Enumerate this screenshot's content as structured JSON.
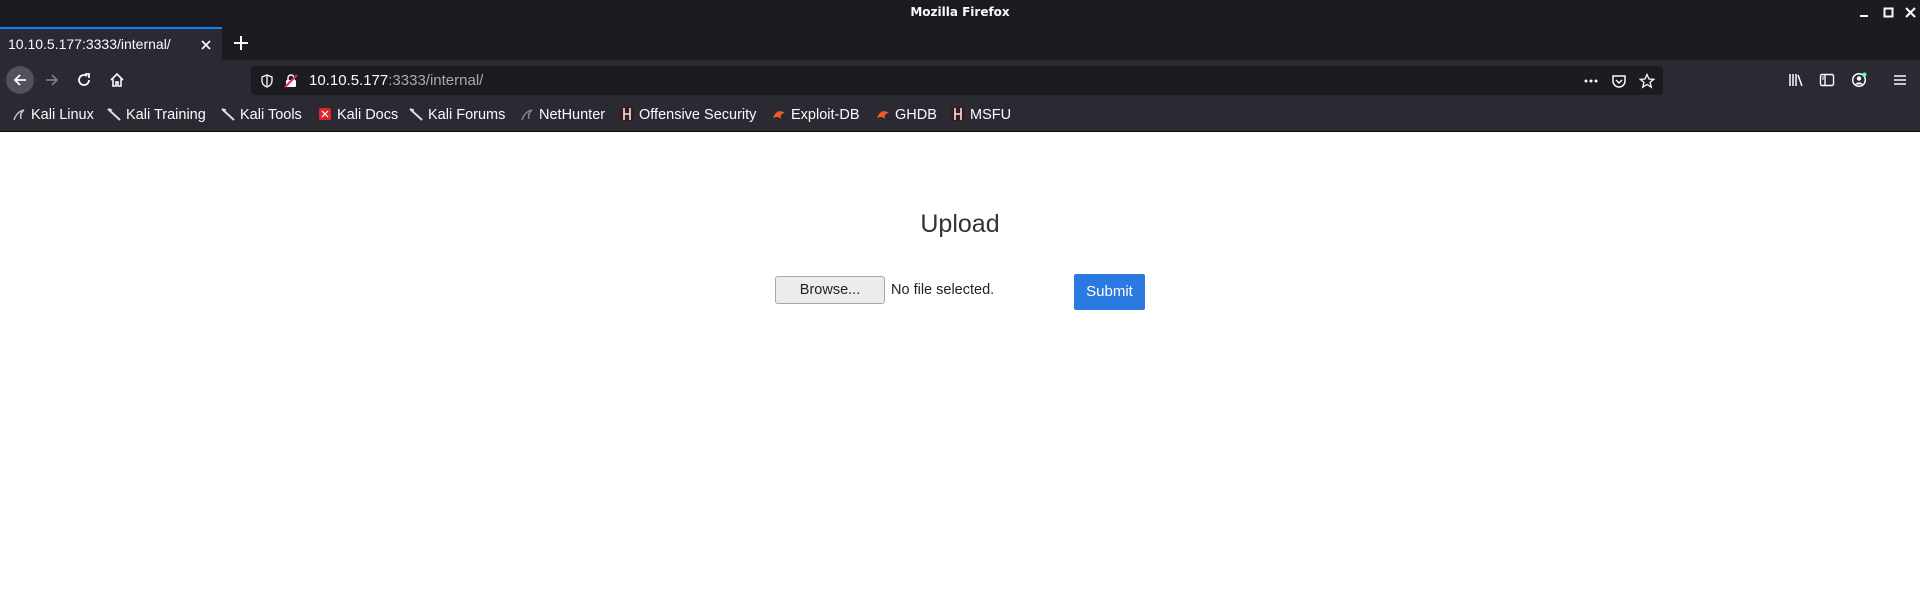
{
  "window": {
    "title": "Mozilla Firefox"
  },
  "tabs": [
    {
      "label": "10.10.5.177:3333/internal/"
    }
  ],
  "urlbar": {
    "host": "10.10.5.177",
    "path": ":3333/internal/"
  },
  "bookmarks": [
    {
      "label": "Kali Linux",
      "icon": "kali-dragon-icon"
    },
    {
      "label": "Kali Training",
      "icon": "kali-dragon-icon"
    },
    {
      "label": "Kali Tools",
      "icon": "kali-dragon-icon"
    },
    {
      "label": "Kali Docs",
      "icon": "kali-docs-icon"
    },
    {
      "label": "Kali Forums",
      "icon": "kali-dragon-icon"
    },
    {
      "label": "NetHunter",
      "icon": "kali-dragon-icon"
    },
    {
      "label": "Offensive Security",
      "icon": "offsec-icon"
    },
    {
      "label": "Exploit-DB",
      "icon": "exploit-db-icon"
    },
    {
      "label": "GHDB",
      "icon": "exploit-db-icon"
    },
    {
      "label": "MSFU",
      "icon": "offsec-icon"
    }
  ],
  "page": {
    "heading": "Upload",
    "browse_label": "Browse...",
    "file_status": "No file selected.",
    "submit_label": "Submit"
  },
  "colors": {
    "accent": "#0a84ff",
    "submit": "#2a7ae2",
    "toolbar": "#2b2a33",
    "titlebar": "#1c1b22"
  }
}
